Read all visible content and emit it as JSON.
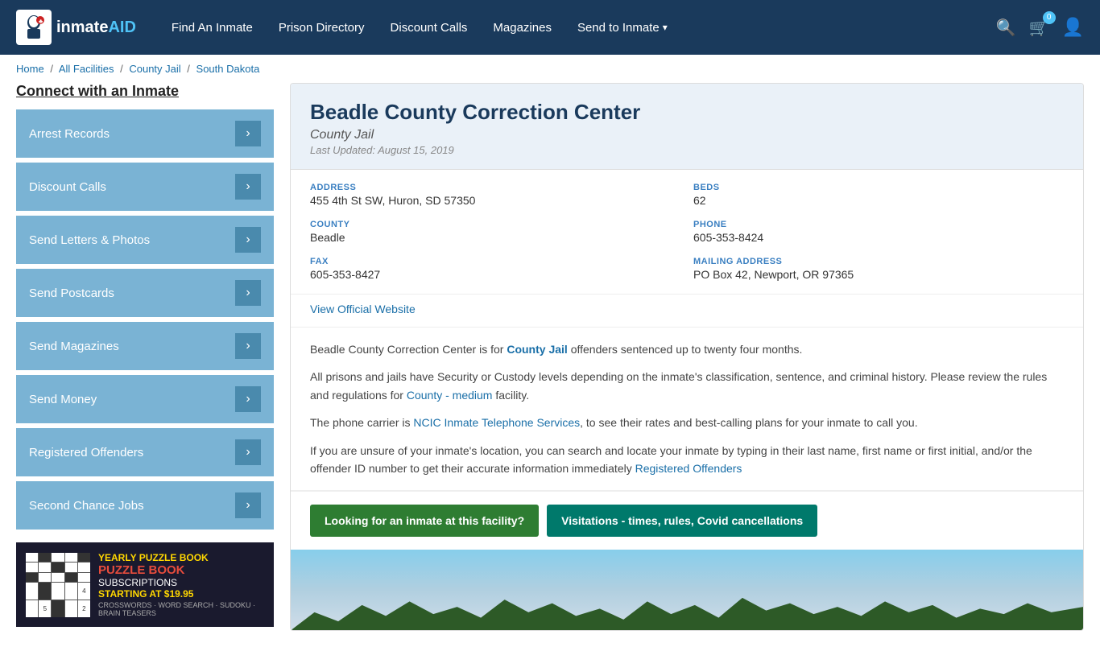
{
  "header": {
    "logo_text": "inmateAID",
    "nav": [
      {
        "label": "Find An Inmate",
        "id": "find-inmate"
      },
      {
        "label": "Prison Directory",
        "id": "prison-directory"
      },
      {
        "label": "Discount Calls",
        "id": "discount-calls"
      },
      {
        "label": "Magazines",
        "id": "magazines"
      },
      {
        "label": "Send to Inmate",
        "id": "send-to-inmate",
        "dropdown": true
      }
    ],
    "cart_count": "0"
  },
  "breadcrumb": {
    "home": "Home",
    "all_facilities": "All Facilities",
    "county_jail": "County Jail",
    "state": "South Dakota"
  },
  "sidebar": {
    "title": "Connect with an Inmate",
    "items": [
      {
        "label": "Arrest Records",
        "id": "arrest-records"
      },
      {
        "label": "Discount Calls",
        "id": "discount-calls"
      },
      {
        "label": "Send Letters & Photos",
        "id": "send-letters"
      },
      {
        "label": "Send Postcards",
        "id": "send-postcards"
      },
      {
        "label": "Send Magazines",
        "id": "send-magazines"
      },
      {
        "label": "Send Money",
        "id": "send-money"
      },
      {
        "label": "Registered Offenders",
        "id": "registered-offenders"
      },
      {
        "label": "Second Chance Jobs",
        "id": "second-chance-jobs"
      }
    ],
    "ad": {
      "yearly": "YEARLY PUZZLE BOOK",
      "subscriptions": "SUBSCRIPTIONS",
      "starting": "STARTING AT $19.95",
      "types": "CROSSWORDS · WORD SEARCH · SUDOKU · BRAIN TEASERS"
    }
  },
  "facility": {
    "name": "Beadle County Correction Center",
    "type": "County Jail",
    "last_updated": "Last Updated: August 15, 2019",
    "address_label": "ADDRESS",
    "address": "455 4th St SW, Huron, SD 57350",
    "beds_label": "BEDS",
    "beds": "62",
    "county_label": "COUNTY",
    "county": "Beadle",
    "phone_label": "PHONE",
    "phone": "605-353-8424",
    "fax_label": "FAX",
    "fax": "605-353-8427",
    "mailing_label": "MAILING ADDRESS",
    "mailing": "PO Box 42, Newport, OR 97365",
    "website_link": "View Official Website",
    "desc1": "Beadle County Correction Center is for ",
    "desc1_link": "County Jail",
    "desc1_cont": " offenders sentenced up to twenty four months.",
    "desc2": "All prisons and jails have Security or Custody levels depending on the inmate's classification, sentence, and criminal history. Please review the rules and regulations for ",
    "desc2_link": "County - medium",
    "desc2_cont": " facility.",
    "desc3": "The phone carrier is ",
    "desc3_link": "NCIC Inmate Telephone Services",
    "desc3_cont": ", to see their rates and best-calling plans for your inmate to call you.",
    "desc4": "If you are unsure of your inmate's location, you can search and locate your inmate by typing in their last name, first name or first initial, and/or the offender ID number to get their accurate information immediately ",
    "desc4_link": "Registered Offenders",
    "btn1": "Looking for an inmate at this facility?",
    "btn2": "Visitations - times, rules, Covid cancellations"
  }
}
